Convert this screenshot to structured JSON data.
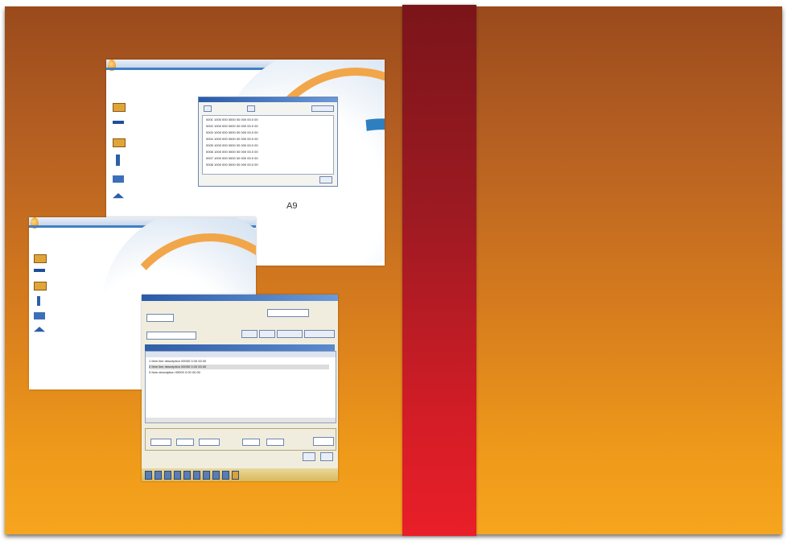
{
  "colors": {
    "cover_top": "#9a4a1c",
    "cover_bottom": "#f6a51f",
    "band_top": "#7a151a",
    "band_bottom": "#e91e28",
    "accent_blue": "#2e7fc0",
    "accent_orange": "#f2a64a"
  },
  "screenshot_top": {
    "sidebar_icons": [
      "folder-open-icon",
      "minus-icon",
      "folder-add-icon",
      "wrench-icon",
      "users-icon",
      "eject-icon"
    ],
    "logo_text": "A9",
    "dialog": {
      "rows": [
        [
          "0001",
          "1000 000 0000 00",
          "000",
          "00.0",
          "00"
        ],
        [
          "0002",
          "1000 000 0000 00",
          "000",
          "00.0",
          "00"
        ],
        [
          "0003",
          "1000 000 0000 00",
          "000",
          "00.0",
          "00"
        ],
        [
          "0004",
          "1000 000 0000 00",
          "000",
          "00.0",
          "00"
        ],
        [
          "0005",
          "1000 000 0000 00",
          "000",
          "00.0",
          "00"
        ],
        [
          "0006",
          "1000 000 0000 00",
          "000",
          "00.0",
          "00"
        ],
        [
          "0007",
          "1000 000 0000 00",
          "000",
          "00.0",
          "00"
        ],
        [
          "0008",
          "1000 000 0000 00",
          "000",
          "00.0",
          "00"
        ]
      ]
    }
  },
  "screenshot_bottom": {
    "sidebar_icons": [
      "folder-open-icon",
      "minus-icon",
      "folder-add-icon",
      "wrench-icon",
      "users-icon",
      "eject-icon"
    ]
  },
  "screenshot_form": {
    "grid_rows": [
      [
        "1",
        "Item line description",
        "00000",
        "0.00",
        "00.00"
      ],
      [
        "2",
        "Item line description",
        "00000",
        "0.00",
        "00.00"
      ],
      [
        "3",
        "Item description",
        "00000",
        "0.00",
        "00.00"
      ]
    ],
    "toolbar_icons": [
      "save-icon",
      "print-icon",
      "search-icon",
      "add-icon",
      "delete-icon",
      "first-icon",
      "prev-icon",
      "next-icon",
      "last-icon",
      "help-icon"
    ]
  }
}
